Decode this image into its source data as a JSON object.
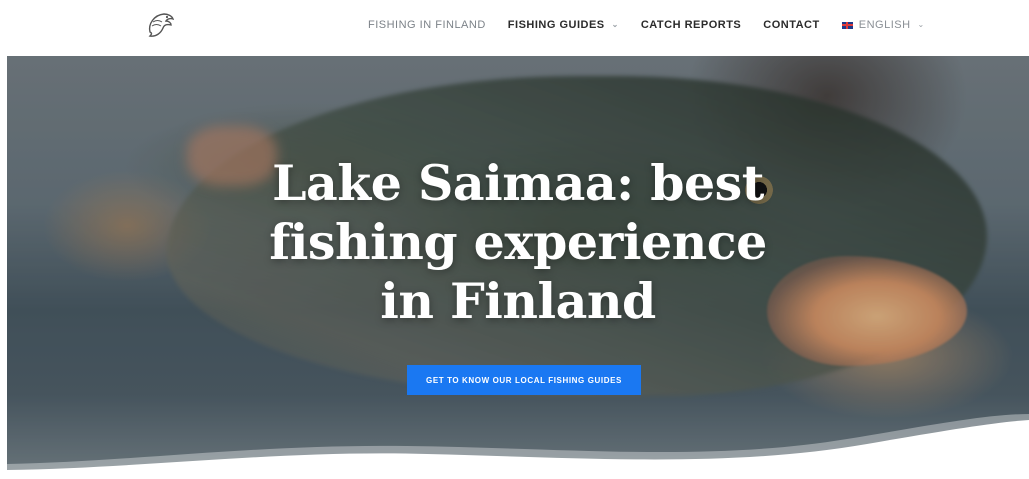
{
  "header": {
    "logo_icon": "pike-fish-logo-icon",
    "nav": [
      {
        "label": "FISHING IN FINLAND",
        "has_dropdown": false
      },
      {
        "label": "FISHING GUIDES",
        "has_dropdown": true
      },
      {
        "label": "CATCH REPORTS",
        "has_dropdown": false
      },
      {
        "label": "CONTACT",
        "has_dropdown": false
      },
      {
        "label": "ENGLISH",
        "has_dropdown": true,
        "icon": "uk-flag-icon"
      }
    ]
  },
  "hero": {
    "title_lines": [
      "Lake Saimaa: best",
      "fishing experience",
      "in Finland"
    ],
    "cta_label": "GET TO KNOW OUR LOCAL FISHING GUIDES",
    "accent_color": "#1a78f2"
  }
}
